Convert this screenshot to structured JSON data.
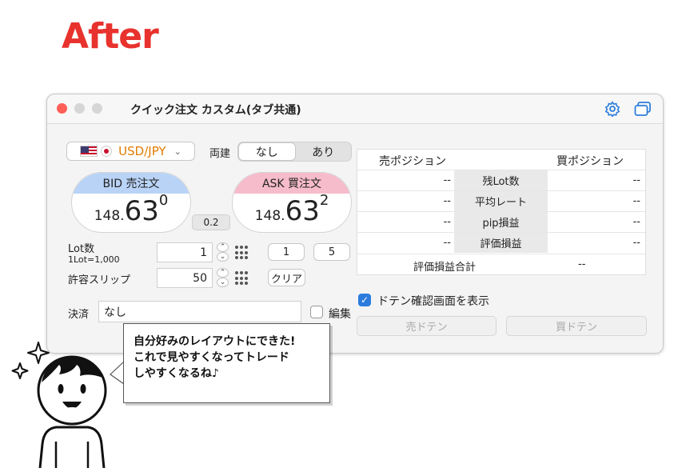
{
  "heading": "After",
  "window": {
    "title": "クイック注文 カスタム(タブ共通)",
    "traffic_colors": [
      "#ff5f57",
      "#d6d6d6",
      "#d6d6d6"
    ],
    "accent": "#2b7cdc"
  },
  "currency": {
    "pair": "USD/JPY",
    "color": "#e07b00"
  },
  "hedge": {
    "label": "両建",
    "options": [
      "なし",
      "あり"
    ],
    "selected": "なし"
  },
  "bid": {
    "label": "BID 売注文",
    "prefix": "148.",
    "big": "63",
    "sup": "0",
    "color": "#b9d3f7"
  },
  "ask": {
    "label": "ASK 買注文",
    "prefix": "148.",
    "big": "63",
    "sup": "2",
    "color": "#f6bccb"
  },
  "spread": "0.2",
  "lot": {
    "label": "Lot数",
    "sub": "1Lot=1,000",
    "value": "1",
    "presets": [
      "1",
      "5"
    ]
  },
  "slip": {
    "label": "許容スリップ",
    "value": "50",
    "clear": "クリア"
  },
  "settle": {
    "label": "決済",
    "value": "なし",
    "edit": "編集"
  },
  "positions": {
    "sell_header": "売ポジション",
    "buy_header": "買ポジション",
    "rows": [
      {
        "label": "残Lot数",
        "sell": "--",
        "buy": "--"
      },
      {
        "label": "平均レート",
        "sell": "--",
        "buy": "--"
      },
      {
        "label": "pip損益",
        "sell": "--",
        "buy": "--"
      },
      {
        "label": "評価損益",
        "sell": "--",
        "buy": "--"
      }
    ],
    "total_label": "評価損益合計",
    "total_value": "--"
  },
  "doten": {
    "confirm_label": "ドテン確認画面を表示",
    "sell": "売ドテン",
    "buy": "買ドテン"
  },
  "bubble": {
    "lines": [
      "自分好みのレイアウトにできた!",
      "これで見やすくなってトレード",
      "しやすくなるね♪"
    ]
  }
}
